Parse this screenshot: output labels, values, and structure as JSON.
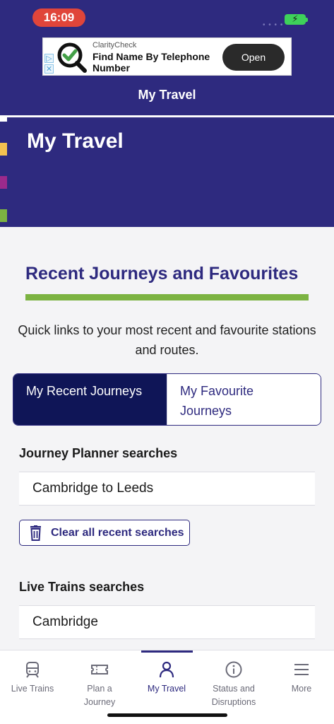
{
  "status_bar": {
    "time": "16:09"
  },
  "ad": {
    "brand": "ClarityCheck",
    "headline": "Find Name By Telephone Number",
    "cta": "Open",
    "check_color": "#43a047"
  },
  "nav": {
    "title": "My Travel"
  },
  "hero": {
    "title": "My Travel",
    "accent_colors": [
      "#ffffff",
      "#f4c150",
      "#9c2a8c",
      "#7cb342"
    ]
  },
  "section": {
    "title": "Recent Journeys and Favourites",
    "intro": "Quick links to your most recent and favourite stations and routes."
  },
  "tabs": [
    {
      "label": "My Recent Journeys",
      "selected": true
    },
    {
      "label": "My Favourite Journeys",
      "selected": false
    }
  ],
  "journey_planner": {
    "title": "Journey Planner searches",
    "items": [
      "Cambridge to Leeds"
    ],
    "clear_label": "Clear all recent searches"
  },
  "live_trains": {
    "title": "Live Trains searches",
    "items": [
      "Cambridge"
    ]
  },
  "tabbar": {
    "items": [
      {
        "label": "Live Trains",
        "icon": "train-icon"
      },
      {
        "label": "Plan a Journey",
        "icon": "ticket-icon"
      },
      {
        "label": "My Travel",
        "icon": "person-icon",
        "active": true
      },
      {
        "label": "Status and Disruptions",
        "icon": "info-icon"
      },
      {
        "label": "More",
        "icon": "menu-icon"
      }
    ]
  },
  "colors": {
    "brand_purple": "#2e2a7f",
    "tab_active": "#0f1557",
    "accent_green": "#7cb342"
  }
}
